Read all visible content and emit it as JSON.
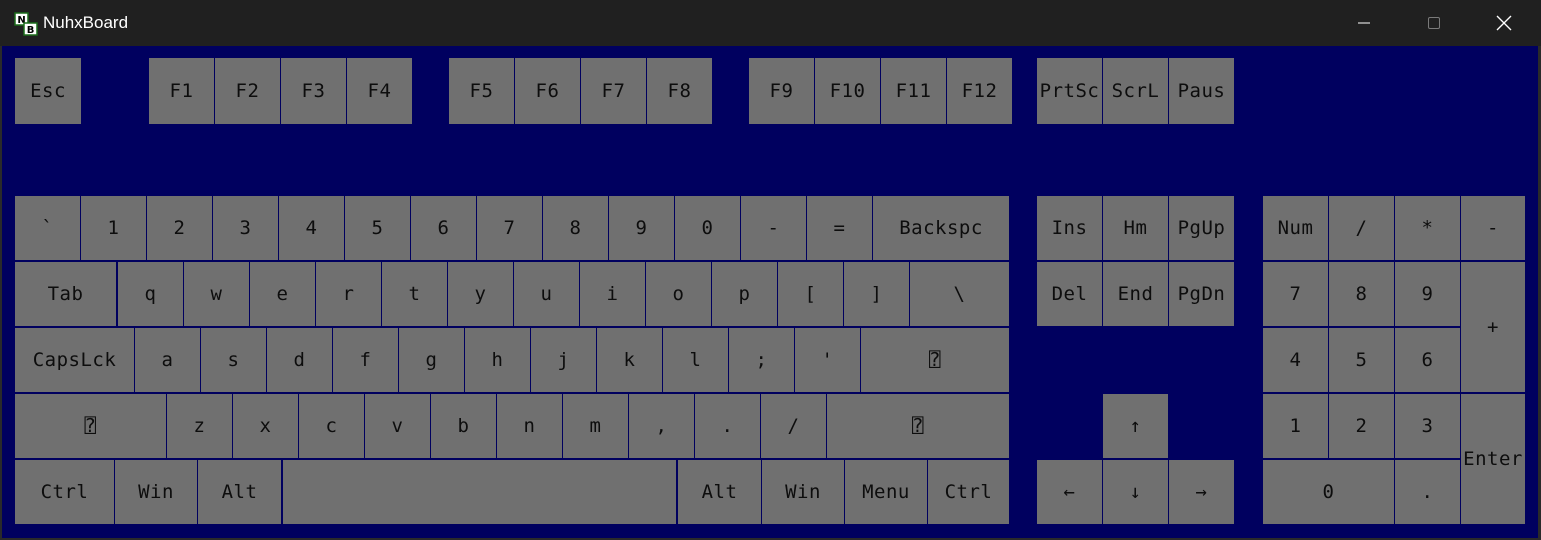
{
  "window": {
    "title": "NuhxBoard",
    "controls": [
      "minimize-icon",
      "maximize-icon",
      "close-icon"
    ]
  },
  "colors": {
    "board_background": "#00005f",
    "key_background": "#707070",
    "key_text": "#0d0d0d",
    "titlebar": "#202020"
  },
  "keys": [
    {
      "id": "esc",
      "label": "Esc"
    },
    {
      "id": "f1",
      "label": "F1"
    },
    {
      "id": "f2",
      "label": "F2"
    },
    {
      "id": "f3",
      "label": "F3"
    },
    {
      "id": "f4",
      "label": "F4"
    },
    {
      "id": "f5",
      "label": "F5"
    },
    {
      "id": "f6",
      "label": "F6"
    },
    {
      "id": "f7",
      "label": "F7"
    },
    {
      "id": "f8",
      "label": "F8"
    },
    {
      "id": "f9",
      "label": "F9"
    },
    {
      "id": "f10",
      "label": "F10"
    },
    {
      "id": "f11",
      "label": "F11"
    },
    {
      "id": "f12",
      "label": "F12"
    },
    {
      "id": "prtsc",
      "label": "PrtSc"
    },
    {
      "id": "scrl",
      "label": "ScrL"
    },
    {
      "id": "paus",
      "label": "Paus"
    },
    {
      "id": "backtick",
      "label": "`"
    },
    {
      "id": "1",
      "label": "1"
    },
    {
      "id": "2",
      "label": "2"
    },
    {
      "id": "3",
      "label": "3"
    },
    {
      "id": "4",
      "label": "4"
    },
    {
      "id": "5",
      "label": "5"
    },
    {
      "id": "6",
      "label": "6"
    },
    {
      "id": "7",
      "label": "7"
    },
    {
      "id": "8",
      "label": "8"
    },
    {
      "id": "9",
      "label": "9"
    },
    {
      "id": "0",
      "label": "0"
    },
    {
      "id": "minus",
      "label": "-"
    },
    {
      "id": "equals",
      "label": "="
    },
    {
      "id": "backspace",
      "label": "Backspc"
    },
    {
      "id": "ins",
      "label": "Ins"
    },
    {
      "id": "hm",
      "label": "Hm"
    },
    {
      "id": "pgup",
      "label": "PgUp"
    },
    {
      "id": "num",
      "label": "Num"
    },
    {
      "id": "np-slash",
      "label": "/"
    },
    {
      "id": "np-star",
      "label": "*"
    },
    {
      "id": "np-minus",
      "label": "-"
    },
    {
      "id": "tab",
      "label": "Tab"
    },
    {
      "id": "q",
      "label": "q"
    },
    {
      "id": "w",
      "label": "w"
    },
    {
      "id": "e",
      "label": "e"
    },
    {
      "id": "r",
      "label": "r"
    },
    {
      "id": "t",
      "label": "t"
    },
    {
      "id": "y",
      "label": "y"
    },
    {
      "id": "u",
      "label": "u"
    },
    {
      "id": "i",
      "label": "i"
    },
    {
      "id": "o",
      "label": "o"
    },
    {
      "id": "p",
      "label": "p"
    },
    {
      "id": "lbracket",
      "label": "["
    },
    {
      "id": "rbracket",
      "label": "]"
    },
    {
      "id": "backslash",
      "label": "\\"
    },
    {
      "id": "del",
      "label": "Del"
    },
    {
      "id": "end",
      "label": "End"
    },
    {
      "id": "pgdn",
      "label": "PgDn"
    },
    {
      "id": "np-7",
      "label": "7"
    },
    {
      "id": "np-8",
      "label": "8"
    },
    {
      "id": "np-9",
      "label": "9"
    },
    {
      "id": "np-plus",
      "label": "+"
    },
    {
      "id": "capslock",
      "label": "CapsLck"
    },
    {
      "id": "a",
      "label": "a"
    },
    {
      "id": "s",
      "label": "s"
    },
    {
      "id": "d",
      "label": "d"
    },
    {
      "id": "f",
      "label": "f"
    },
    {
      "id": "g",
      "label": "g"
    },
    {
      "id": "h",
      "label": "h"
    },
    {
      "id": "j",
      "label": "j"
    },
    {
      "id": "k",
      "label": "k"
    },
    {
      "id": "l",
      "label": "l"
    },
    {
      "id": "semicolon",
      "label": ";"
    },
    {
      "id": "quote",
      "label": "'"
    },
    {
      "id": "enter",
      "label": "⍰"
    },
    {
      "id": "np-4",
      "label": "4"
    },
    {
      "id": "np-5",
      "label": "5"
    },
    {
      "id": "np-6",
      "label": "6"
    },
    {
      "id": "lshift",
      "label": "⍰"
    },
    {
      "id": "z",
      "label": "z"
    },
    {
      "id": "x",
      "label": "x"
    },
    {
      "id": "c",
      "label": "c"
    },
    {
      "id": "v",
      "label": "v"
    },
    {
      "id": "b",
      "label": "b"
    },
    {
      "id": "n",
      "label": "n"
    },
    {
      "id": "m",
      "label": "m"
    },
    {
      "id": "comma",
      "label": ","
    },
    {
      "id": "period",
      "label": "."
    },
    {
      "id": "slash",
      "label": "/"
    },
    {
      "id": "rshift",
      "label": "⍰"
    },
    {
      "id": "up",
      "label": "↑"
    },
    {
      "id": "np-1",
      "label": "1"
    },
    {
      "id": "np-2",
      "label": "2"
    },
    {
      "id": "np-3",
      "label": "3"
    },
    {
      "id": "np-enter",
      "label": "Enter"
    },
    {
      "id": "lctrl",
      "label": "Ctrl"
    },
    {
      "id": "lwin",
      "label": "Win"
    },
    {
      "id": "lalt",
      "label": "Alt"
    },
    {
      "id": "space",
      "label": ""
    },
    {
      "id": "ralt",
      "label": "Alt"
    },
    {
      "id": "rwin",
      "label": "Win"
    },
    {
      "id": "menu",
      "label": "Menu"
    },
    {
      "id": "rctrl",
      "label": "Ctrl"
    },
    {
      "id": "left",
      "label": "←"
    },
    {
      "id": "down",
      "label": "↓"
    },
    {
      "id": "right",
      "label": "→"
    },
    {
      "id": "np-0",
      "label": "0"
    },
    {
      "id": "np-dot",
      "label": "."
    }
  ]
}
